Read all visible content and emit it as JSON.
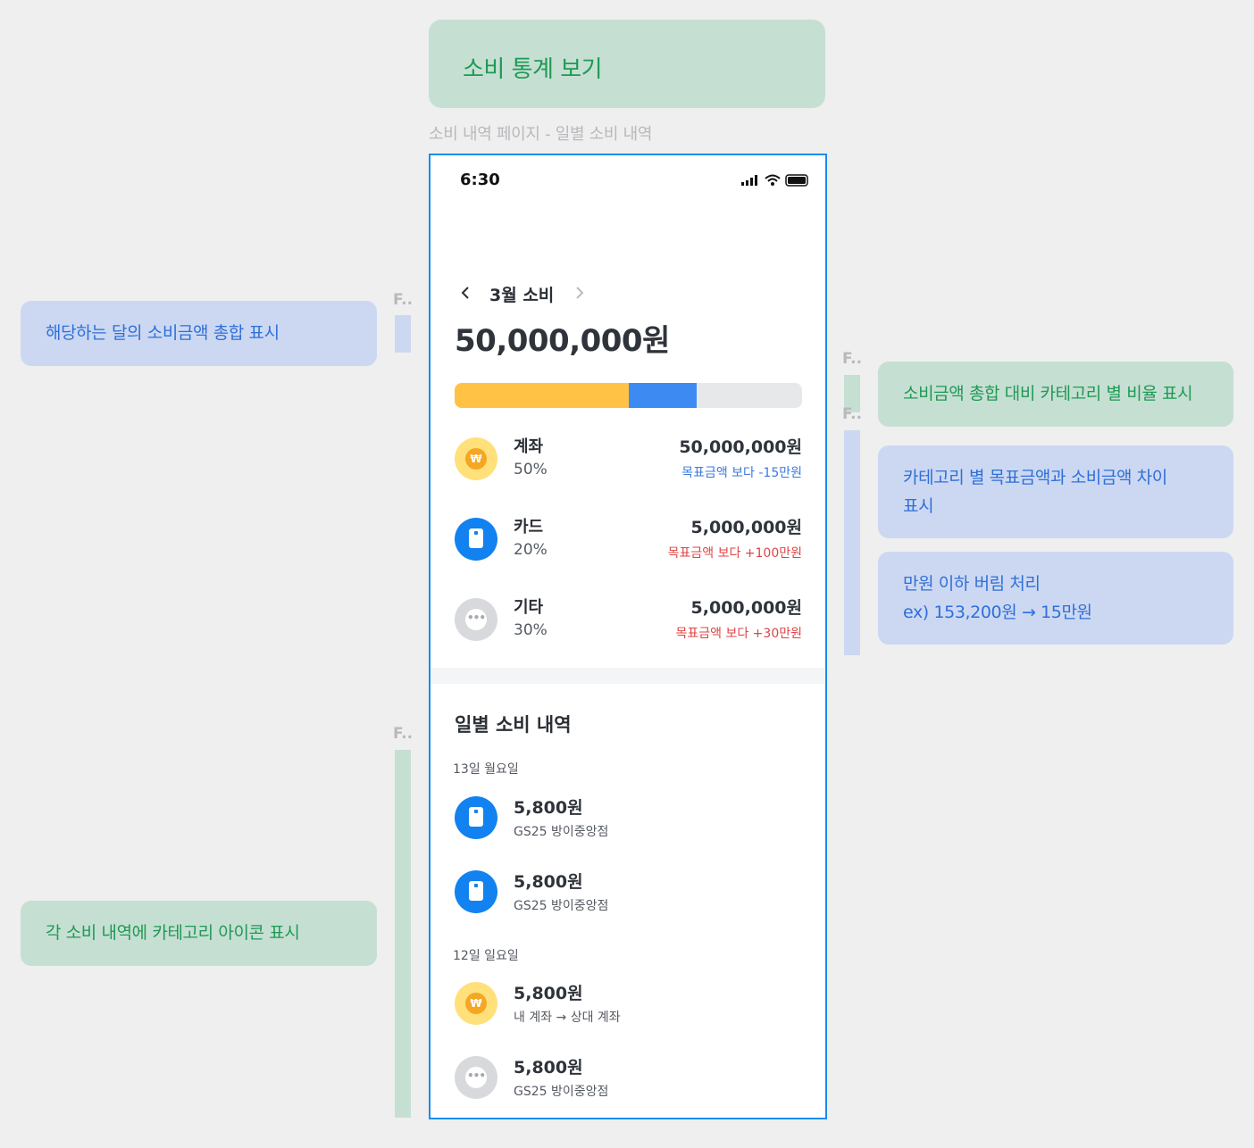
{
  "header": {
    "title": "소비 통계 보기",
    "frame_label": "소비 내역 페이지 - 일별 소비 내역"
  },
  "annotations": {
    "bar_label": "F..",
    "monthly_total": "해당하는 달의 소비금액 총합 표시",
    "category_ratio": "소비금액 총합 대비 카테고리 별 비율 표시",
    "goal_diff_line1": "카테고리 별 목표금액과 소비금액 차이",
    "goal_diff_line2": "표시",
    "rounding_line1": "만원 이하 버림 처리",
    "rounding_line2": "ex) 153,200원 → 15만원",
    "category_icon": "각 소비 내역에 카테고리 아이콘 표시"
  },
  "status_bar": {
    "time": "6:30"
  },
  "summary": {
    "month_label": "3월 소비",
    "total": "50,000,000원",
    "ratio_bar": [
      {
        "name": "계좌",
        "fraction": 0.5,
        "color": "#ffc244"
      },
      {
        "name": "카드",
        "fraction": 0.196,
        "color": "#3d8bf2"
      },
      {
        "name": "기타",
        "fraction": 0.304,
        "color": "#e7e8ea"
      }
    ]
  },
  "colors": {
    "accent_blue": "#1a8cf0",
    "green_note": "#c6dfd3",
    "blue_note": "#ccd8f2"
  },
  "categories": [
    {
      "name": "계좌",
      "percent": "50%",
      "amount": "50,000,000원",
      "diff": "목표금액 보다 -15만원",
      "icon": "won-coin-icon"
    },
    {
      "name": "카드",
      "percent": "20%",
      "amount": "5,000,000원",
      "diff": "목표금액 보다 +100만원",
      "icon": "card-icon"
    },
    {
      "name": "기타",
      "percent": "30%",
      "amount": "5,000,000원",
      "diff": "목표금액 보다 +30만원",
      "icon": "more-dots-icon"
    }
  ],
  "daily": {
    "title": "일별 소비 내역",
    "days": [
      {
        "label": "13일 월요일",
        "items": [
          {
            "amount": "5,800원",
            "desc": "GS25 방이중앙점",
            "icon": "card-icon"
          },
          {
            "amount": "5,800원",
            "desc": "GS25 방이중앙점",
            "icon": "card-icon"
          }
        ]
      },
      {
        "label": "12일 일요일",
        "items": [
          {
            "amount": "5,800원",
            "desc": "내 계좌 → 상대 계좌",
            "icon": "won-coin-icon"
          },
          {
            "amount": "5,800원",
            "desc": "GS25 방이중앙점",
            "icon": "more-dots-icon"
          }
        ]
      }
    ]
  }
}
